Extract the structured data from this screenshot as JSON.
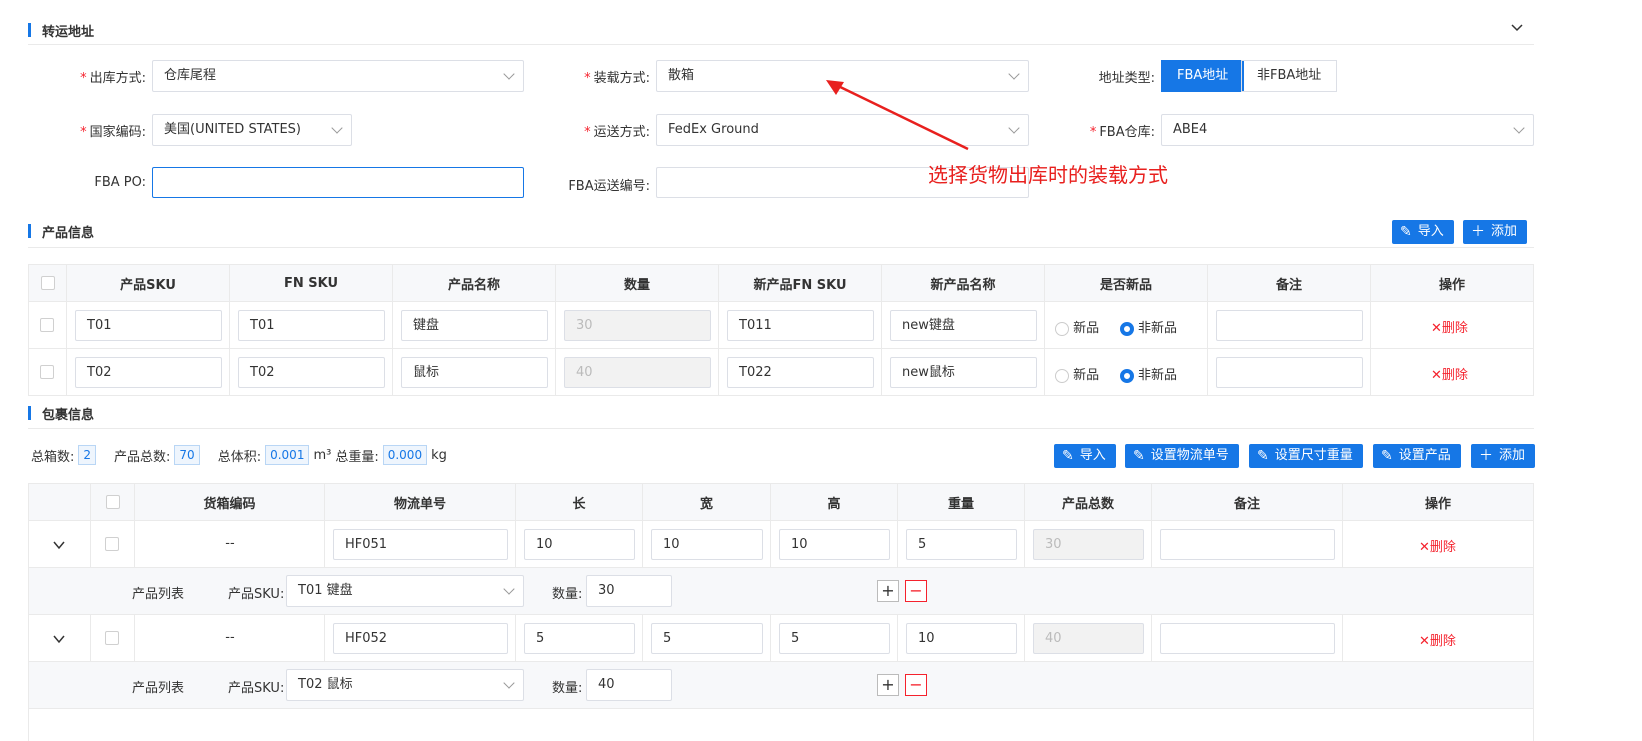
{
  "shipping_address": {
    "title": "转运地址",
    "outbound_method": {
      "label": "出库方式:",
      "value": "仓库尾程"
    },
    "loading_method": {
      "label": "装载方式:",
      "value": "散箱"
    },
    "address_type": {
      "label": "地址类型:",
      "options": [
        "FBA地址",
        "非FBA地址"
      ],
      "selected": "FBA地址"
    },
    "country_code": {
      "label": "国家编码:",
      "value": "美国(UNITED STATES)"
    },
    "shipping_method": {
      "label": "运送方式:",
      "value": "FedEx Ground"
    },
    "fba_warehouse": {
      "label": "FBA仓库:",
      "value": "ABE4"
    },
    "fba_po": {
      "label": "FBA PO:",
      "value": ""
    },
    "fba_shipment_no": {
      "label": "FBA运送编号:",
      "value": ""
    }
  },
  "annotation": "选择货物出库时的装载方式",
  "product_info": {
    "title": "产品信息",
    "buttons": {
      "import": "导入",
      "add": "添加"
    },
    "columns": [
      "产品SKU",
      "FN SKU",
      "产品名称",
      "数量",
      "新产品FN SKU",
      "新产品名称",
      "是否新品",
      "备注",
      "操作"
    ],
    "radio_labels": {
      "new": "新品",
      "not_new": "非新品"
    },
    "delete_label": "删除",
    "rows": [
      {
        "sku": "T01",
        "fnsku": "T01",
        "name": "键盘",
        "qty": "30",
        "new_fnsku": "T011",
        "new_name": "new键盘",
        "is_new": false,
        "remark": ""
      },
      {
        "sku": "T02",
        "fnsku": "T02",
        "name": "鼠标",
        "qty": "40",
        "new_fnsku": "T022",
        "new_name": "new鼠标",
        "is_new": false,
        "remark": ""
      }
    ]
  },
  "package_info": {
    "title": "包裹信息",
    "stats": {
      "total_boxes_label": "总箱数:",
      "total_boxes": "2",
      "total_products_label": "产品总数:",
      "total_products": "70",
      "total_volume_label": "总体积:",
      "total_volume": "0.001",
      "volume_unit": "m³",
      "total_weight_label": "总重量:",
      "total_weight": "0.000",
      "weight_unit": "kg"
    },
    "buttons": {
      "import": "导入",
      "set_tracking": "设置物流单号",
      "set_dims": "设置尺寸重量",
      "set_product": "设置产品",
      "add": "添加"
    },
    "columns": [
      "货箱编码",
      "物流单号",
      "长",
      "宽",
      "高",
      "重量",
      "产品总数",
      "备注",
      "操作"
    ],
    "product_list_label": "产品列表",
    "product_sku_label": "产品SKU:",
    "qty_label": "数量:",
    "delete_label": "删除",
    "boxes": [
      {
        "code": "--",
        "tracking": "HF051",
        "length": "10",
        "width": "10",
        "height": "10",
        "weight": "5",
        "total": "30",
        "remark": "",
        "product_sku": "T01 键盘",
        "qty": "30"
      },
      {
        "code": "--",
        "tracking": "HF052",
        "length": "5",
        "width": "5",
        "height": "5",
        "weight": "10",
        "total": "40",
        "remark": "",
        "product_sku": "T02 鼠标",
        "qty": "40"
      }
    ]
  }
}
